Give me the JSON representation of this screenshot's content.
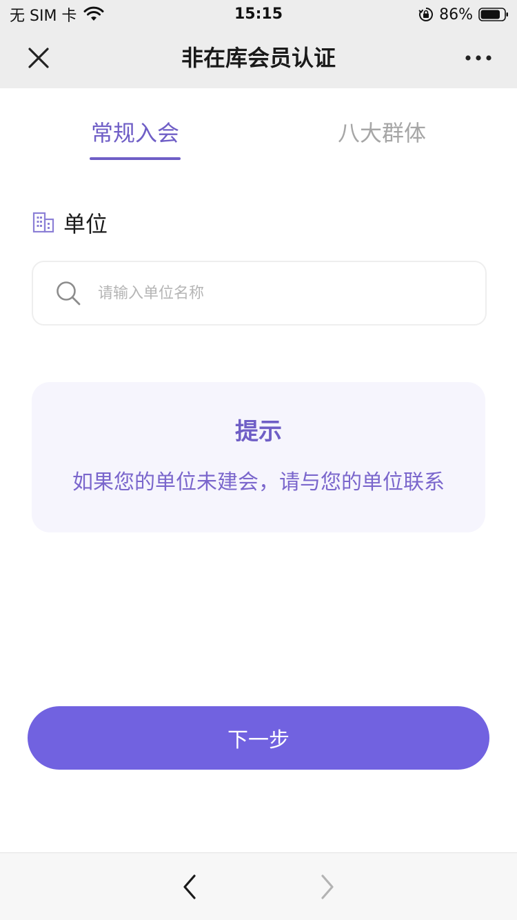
{
  "status_bar": {
    "carrier": "无 SIM 卡",
    "time": "15:15",
    "battery_percent": "86%",
    "battery_level": 0.86,
    "icons": [
      "wifi-icon",
      "orientation-lock-icon",
      "battery-icon"
    ]
  },
  "nav": {
    "title": "非在库会员认证",
    "icons": [
      "close-icon",
      "more-icon"
    ]
  },
  "tabs": [
    {
      "label": "常规入会",
      "active": true
    },
    {
      "label": "八大群体",
      "active": false
    }
  ],
  "form": {
    "unit_label": "单位",
    "unit_icon": "building-icon",
    "search_placeholder": "请输入单位名称",
    "search_value": "",
    "search_icon": "search-icon"
  },
  "tip": {
    "title": "提示",
    "text": "如果您的单位未建会，请与您的单位联系"
  },
  "next_button": {
    "label": "下一步"
  },
  "bottom_bar": {
    "icons": [
      "back-arrow-icon",
      "forward-arrow-icon"
    ]
  },
  "colors": {
    "accent": "#6f5ec6",
    "button": "#7162e0",
    "tip_background": "#f6f5fd",
    "header_background": "#ededed"
  }
}
